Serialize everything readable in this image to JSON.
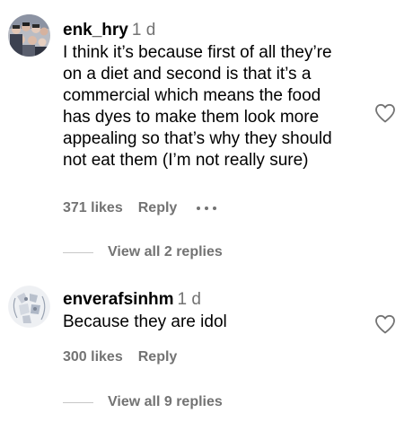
{
  "comments": [
    {
      "username": "enk_hry",
      "time": "1 d",
      "lines": [
        "I think it’s because first of all they’re",
        "on a diet and second is that it’s a",
        "commercial which means the food",
        "has dyes to make them look more",
        "appealing so that’s why they should",
        "not eat them (I’m not really sure)"
      ],
      "likes": "371 likes",
      "reply": "Reply",
      "view_replies": "View all 2 replies",
      "avatar_icon": "group-photo-avatar",
      "like_icon": "heart-outline-icon"
    },
    {
      "username": "enverafsinhm",
      "time": "1 d",
      "lines": [
        "Because they are idol"
      ],
      "likes": "300 likes",
      "reply": "Reply",
      "view_replies": "View all 9 replies",
      "avatar_icon": "illustration-avatar",
      "like_icon": "heart-outline-icon"
    }
  ],
  "colors": {
    "text": "#000000",
    "secondary": "#737373",
    "divider": "#c7c7c7"
  }
}
